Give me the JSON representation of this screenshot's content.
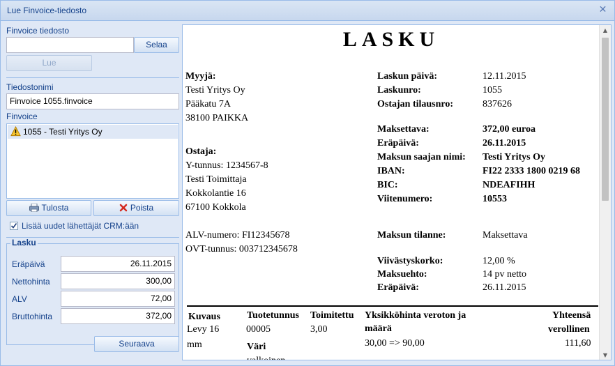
{
  "window": {
    "title": "Lue Finvoice-tiedosto"
  },
  "left": {
    "file_label": "Finvoice tiedosto",
    "file_value": "",
    "browse_label": "Selaa",
    "read_label": "Lue",
    "filename_label": "Tiedostonimi",
    "filename_value": "Finvoice 1055.finvoice",
    "finvoice_label": "Finvoice",
    "list_items": [
      "1055 - Testi Yritys Oy"
    ],
    "print_label": "Tulosta",
    "remove_label": "Poista",
    "crm_checkbox_label": "Lisää uudet lähettäjät CRM:ään",
    "crm_checked": true,
    "invoice_legend": "Lasku",
    "fields": [
      {
        "label": "Eräpäivä",
        "value": "26.11.2015"
      },
      {
        "label": "Nettohinta",
        "value": "300,00"
      },
      {
        "label": "ALV",
        "value": "72,00"
      },
      {
        "label": "Bruttohinta",
        "value": "372,00"
      }
    ],
    "next_label": "Seuraava"
  },
  "doc": {
    "title": "LASKU",
    "seller_heading": "Myyjä:",
    "seller_lines": [
      "Testi Yritys Oy",
      "Pääkatu 7A",
      "38100 PAIKKA"
    ],
    "buyer_heading": "Ostaja:",
    "buyer_lines": [
      "Y-tunnus: 1234567-8",
      "Testi Toimittaja",
      "Kokkolantie 16",
      "67100 Kokkola"
    ],
    "vat_number": "ALV-numero: FI12345678",
    "ovt": "OVT-tunnus: 003712345678",
    "info_rows": [
      {
        "label": "Laskun päivä:",
        "value": "12.11.2015",
        "bold": false
      },
      {
        "label": "Laskunro:",
        "value": "1055",
        "bold": false
      },
      {
        "label": "Ostajan tilausnro:",
        "value": "837626",
        "bold": false
      },
      {
        "label": "Maksettava:",
        "value": "372,00 euroa",
        "bold": true
      },
      {
        "label": "Eräpäivä:",
        "value": "26.11.2015",
        "bold": true
      },
      {
        "label": "Maksun saajan nimi:",
        "value": "Testi Yritys Oy",
        "bold": true
      },
      {
        "label": "IBAN:",
        "value": "FI22 2333 1800 0219 68",
        "bold": true
      },
      {
        "label": "BIC:",
        "value": "NDEAFIHH",
        "bold": true
      },
      {
        "label": "Viitenumero:",
        "value": "10553",
        "bold": true
      },
      {
        "label": "Maksun tilanne:",
        "value": "Maksettava",
        "bold": false
      },
      {
        "label": "Viivästyskorko:",
        "value": "12,00 %",
        "bold": false
      },
      {
        "label": "Maksuehto:",
        "value": "14 pv netto",
        "bold": false
      },
      {
        "label": "Eräpäivä:",
        "value": "26.11.2015",
        "bold": false
      }
    ],
    "table": {
      "h_kuvaus": "Kuvaus",
      "h_tuote": "Tuotetunnus",
      "h_toimitettu": "Toimitettu",
      "h_yks_1": "Yksikköhinta veroton ja",
      "h_yks_2": "määrä",
      "h_yht_1": "Yhteensä",
      "h_yht_2": "verollinen",
      "row_kuvaus_1": "Levy 16",
      "row_kuvaus_2": "mm",
      "row_tuote": "00005",
      "row_toimitettu": "3,00",
      "row_yks": "30,00 => 90,00",
      "row_yht": "111,60",
      "sub_label": "Väri",
      "sub_value": "valkoinen"
    }
  }
}
